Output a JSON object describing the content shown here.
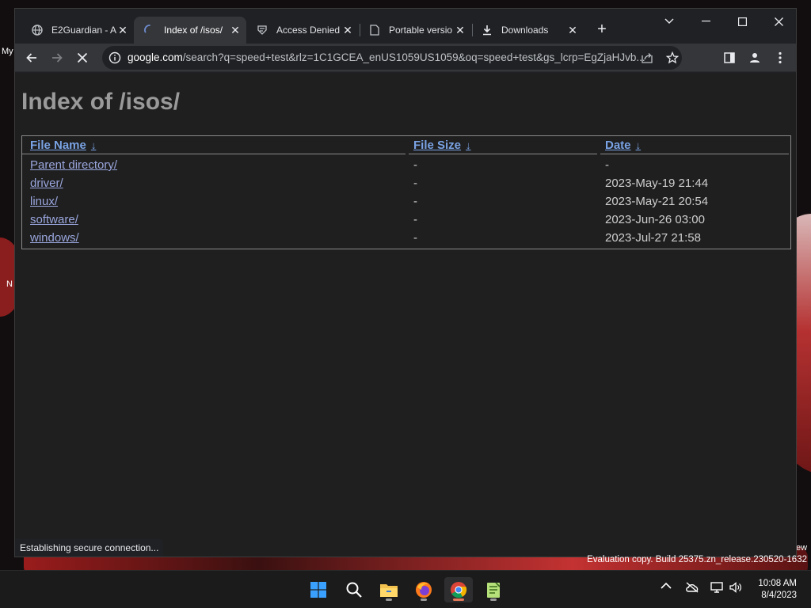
{
  "desktop": {
    "left_labels": [
      "My",
      "N"
    ],
    "right_label": "ew",
    "evaluation_text": "Evaluation copy. Build 25375.zn_release.230520-1632"
  },
  "browser": {
    "tabs": [
      {
        "title": "E2Guardian - A",
        "icon": "globe-icon",
        "active": false
      },
      {
        "title": "Index of /isos/",
        "icon": "loading-spinner-icon",
        "active": true
      },
      {
        "title": "Access Denied",
        "icon": "site-icon",
        "active": false
      },
      {
        "title": "Portable versio",
        "icon": "page-icon",
        "active": false
      },
      {
        "title": "Downloads",
        "icon": "download-icon",
        "active": false
      }
    ],
    "address_bar": {
      "host": "google.com",
      "rest": "/search?q=speed+test&rlz=1C1GCEA_enUS1059US1059&oq=speed+test&gs_lcrp=EgZjaHJvb..."
    },
    "status_text": "Establishing secure connection..."
  },
  "page": {
    "title": "Index of /isos/",
    "columns": {
      "name": "File Name",
      "size": "File Size",
      "date": "Date",
      "sort_symbol": "↓"
    },
    "rows": [
      {
        "name": "Parent directory/",
        "size": "-",
        "date": "-"
      },
      {
        "name": "driver/",
        "size": "-",
        "date": "2023-May-19 21:44"
      },
      {
        "name": "linux/",
        "size": "-",
        "date": "2023-May-21 20:54"
      },
      {
        "name": "software/",
        "size": "-",
        "date": "2023-Jun-26 03:00"
      },
      {
        "name": "windows/",
        "size": "-",
        "date": "2023-Jul-27 21:58"
      }
    ]
  },
  "taskbar": {
    "apps": [
      "start-icon",
      "search-icon",
      "file-explorer-icon",
      "firefox-icon",
      "chrome-icon",
      "notepad-plus-icon"
    ],
    "active_app": "chrome-icon",
    "clock": {
      "time": "10:08 AM",
      "date": "8/4/2023"
    }
  },
  "colors": {
    "page_background": "#1f1f1f",
    "link": "#9aa6dd",
    "header_link": "#7aa3e5",
    "title": "#9a9a9a"
  }
}
